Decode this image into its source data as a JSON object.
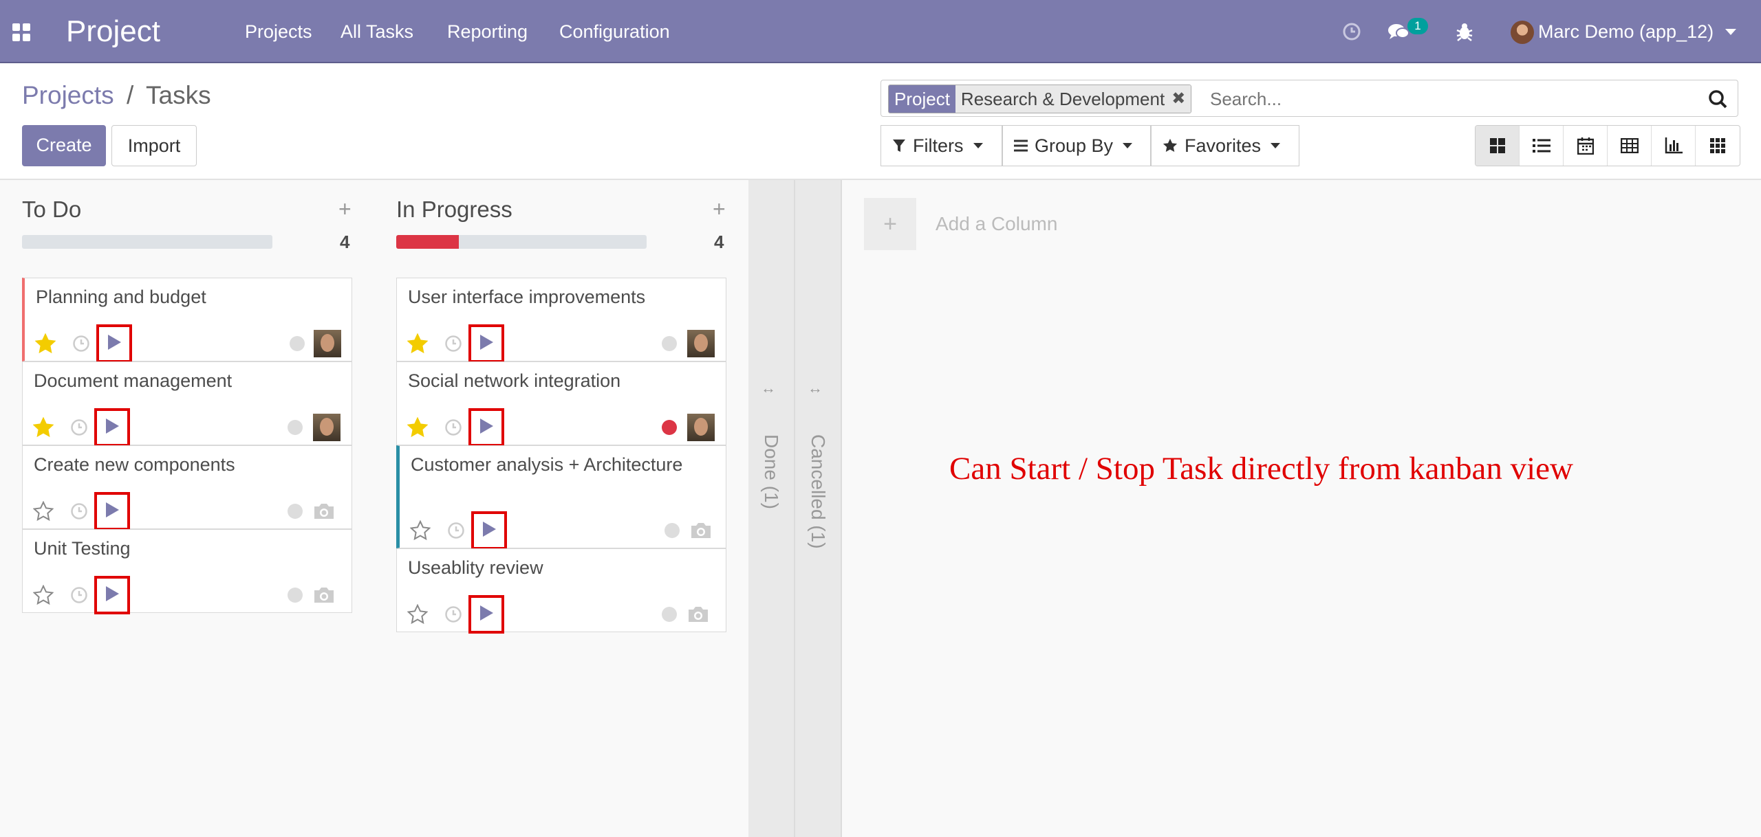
{
  "navbar": {
    "app_title": "Project",
    "menu": [
      "Projects",
      "All Tasks",
      "Reporting",
      "Configuration"
    ],
    "message_count": "1",
    "user_name": "Marc Demo (app_12)"
  },
  "breadcrumb": {
    "parent": "Projects",
    "separator": "/",
    "current": "Tasks"
  },
  "buttons": {
    "create": "Create",
    "import": "Import"
  },
  "search": {
    "facet_label": "Project",
    "facet_value": "Research & Development",
    "facet_remove": "✖",
    "placeholder": "Search..."
  },
  "filters": {
    "filters": "Filters",
    "group_by": "Group By",
    "favorites": "Favorites"
  },
  "views": [
    "kanban",
    "list",
    "calendar",
    "pivot",
    "graph",
    "activity"
  ],
  "columns": [
    {
      "title": "To Do",
      "count": "4",
      "progress_red": 0,
      "cards": [
        {
          "title": "Planning and budget",
          "starred": true,
          "status": "normal",
          "assigned": true
        },
        {
          "title": "Document management",
          "starred": true,
          "status": "normal",
          "assigned": true
        },
        {
          "title": "Create new components",
          "starred": false,
          "status": "normal",
          "assigned": false
        },
        {
          "title": "Unit Testing",
          "starred": false,
          "status": "normal",
          "assigned": false
        }
      ]
    },
    {
      "title": "In Progress",
      "count": "4",
      "progress_red": 0.25,
      "cards": [
        {
          "title": "User interface improvements",
          "starred": true,
          "status": "normal",
          "assigned": true
        },
        {
          "title": "Social network integration",
          "starred": true,
          "status": "blocked",
          "assigned": true
        },
        {
          "title": "Customer analysis + Architecture",
          "starred": false,
          "status": "normal",
          "assigned": false
        },
        {
          "title": "Useablity review",
          "starred": false,
          "status": "normal",
          "assigned": false
        }
      ]
    }
  ],
  "folded_columns": [
    {
      "label": "Done (1)"
    },
    {
      "label": "Cancelled (1)"
    }
  ],
  "add_column": {
    "label": "Add a Column"
  },
  "annotation": "Can Start / Stop Task directly from kanban view",
  "colors": {
    "navbar": "#7c7bad",
    "annotation": "#e00000",
    "blocked": "#dc3545",
    "star": "#f3cc00"
  }
}
